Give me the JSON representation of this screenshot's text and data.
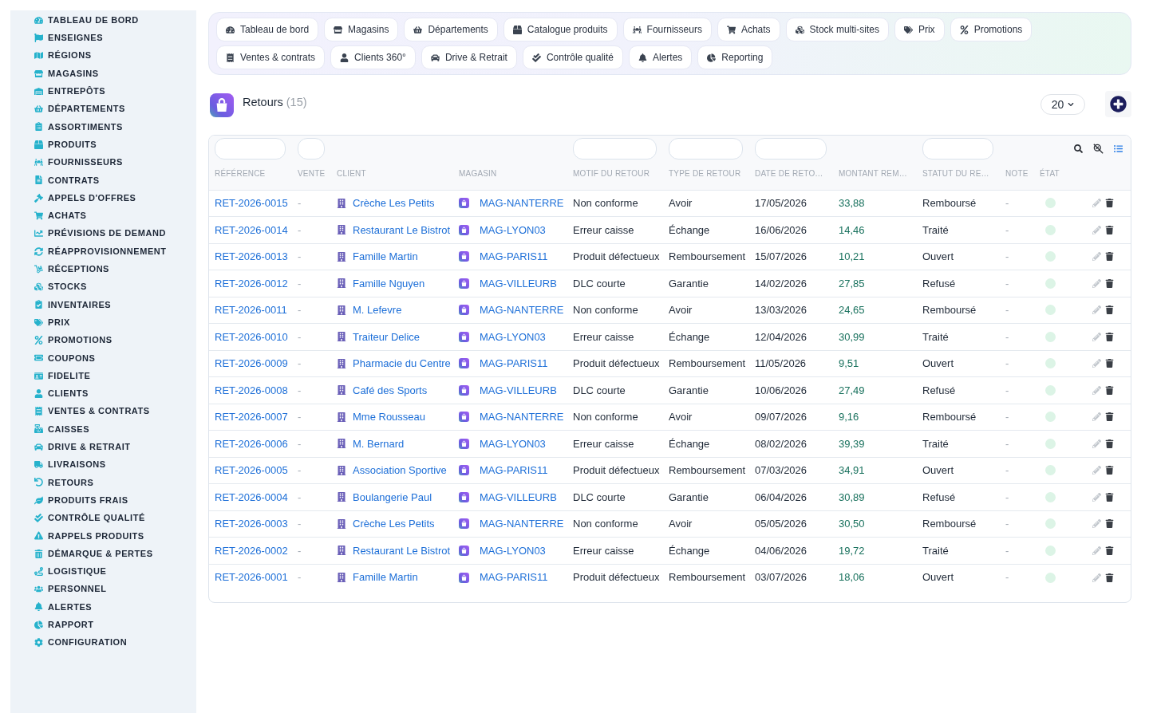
{
  "sidebar": {
    "items": [
      {
        "label": "TABLEAU DE BORD"
      },
      {
        "label": "ENSEIGNES"
      },
      {
        "label": "RÉGIONS"
      },
      {
        "label": "MAGASINS"
      },
      {
        "label": "ENTREPÔTS"
      },
      {
        "label": "DÉPARTEMENTS"
      },
      {
        "label": "ASSORTIMENTS"
      },
      {
        "label": "PRODUITS"
      },
      {
        "label": "FOURNISSEURS"
      },
      {
        "label": "CONTRATS"
      },
      {
        "label": "APPELS D'OFFRES"
      },
      {
        "label": "ACHATS"
      },
      {
        "label": "PRÉVISIONS DE DEMAND"
      },
      {
        "label": "RÉAPPROVISIONNEMENT"
      },
      {
        "label": "RÉCEPTIONS"
      },
      {
        "label": "STOCKS"
      },
      {
        "label": "INVENTAIRES"
      },
      {
        "label": "PRIX"
      },
      {
        "label": "PROMOTIONS"
      },
      {
        "label": "COUPONS"
      },
      {
        "label": "FIDELITE"
      },
      {
        "label": "CLIENTS"
      },
      {
        "label": "VENTES & CONTRATS"
      },
      {
        "label": "CAISSES"
      },
      {
        "label": "DRIVE & RETRAIT"
      },
      {
        "label": "LIVRAISONS"
      },
      {
        "label": "RETOURS"
      },
      {
        "label": "PRODUITS FRAIS"
      },
      {
        "label": "CONTRÔLE QUALITÉ"
      },
      {
        "label": "RAPPELS PRODUITS"
      },
      {
        "label": "DÉMARQUE & PERTES"
      },
      {
        "label": "LOGISTIQUE"
      },
      {
        "label": "PERSONNEL"
      },
      {
        "label": "ALERTES"
      },
      {
        "label": "RAPPORT"
      },
      {
        "label": "CONFIGURATION"
      }
    ]
  },
  "shortcuts": {
    "rows": [
      [
        {
          "label": "Tableau de bord"
        },
        {
          "label": "Magasins"
        },
        {
          "label": "Départements"
        },
        {
          "label": "Catalogue produits"
        },
        {
          "label": "Fournisseurs"
        },
        {
          "label": "Achats"
        },
        {
          "label": "Stock multi-sites"
        },
        {
          "label": "Prix"
        },
        {
          "label": "Promotions"
        }
      ],
      [
        {
          "label": "Ventes & contrats"
        },
        {
          "label": "Clients 360°"
        },
        {
          "label": "Drive & Retrait"
        },
        {
          "label": "Contrôle qualité"
        },
        {
          "label": "Alertes"
        },
        {
          "label": "Reporting"
        }
      ]
    ]
  },
  "page": {
    "title": "Retours",
    "count": "(15)",
    "page_size": "20"
  },
  "table": {
    "columns": [
      {
        "label": "RÉFÉRENCE",
        "filter": true
      },
      {
        "label": "VENTE",
        "filter": true
      },
      {
        "label": "CLIENT",
        "filter": false
      },
      {
        "label": "MAGASIN",
        "filter": false
      },
      {
        "label": "MOTIF DU RETOUR",
        "filter": true
      },
      {
        "label": "TYPE DE RETOUR",
        "filter": true
      },
      {
        "label": "DATE DE RETO…",
        "filter": true
      },
      {
        "label": "MONTANT REM…",
        "filter": false
      },
      {
        "label": "STATUT DU RE…",
        "filter": true
      },
      {
        "label": "NOTE",
        "filter": false
      },
      {
        "label": "ÉTAT",
        "filter": false
      }
    ],
    "rows": [
      {
        "reference": "RET-2026-0015",
        "sale": "-",
        "client": "Crèche Les Petits",
        "store": "MAG-NANTERRE",
        "reason": "Non conforme",
        "type": "Avoir",
        "date": "17/05/2026",
        "amount": "33,88",
        "status": "Remboursé",
        "note": "-",
        "color": "#dcf4e6"
      },
      {
        "reference": "RET-2026-0014",
        "sale": "-",
        "client": "Restaurant Le Bistrot",
        "store": "MAG-LYON03",
        "reason": "Erreur caisse",
        "type": "Échange",
        "date": "16/06/2026",
        "amount": "14,46",
        "status": "Traité",
        "note": "-",
        "color": "#dcf4e6"
      },
      {
        "reference": "RET-2026-0013",
        "sale": "-",
        "client": "Famille Martin",
        "store": "MAG-PARIS11",
        "reason": "Produit défectueux",
        "type": "Remboursement",
        "date": "15/07/2026",
        "amount": "10,21",
        "status": "Ouvert",
        "note": "-",
        "color": "#dcf4e6"
      },
      {
        "reference": "RET-2026-0012",
        "sale": "-",
        "client": "Famille Nguyen",
        "store": "MAG-VILLEURB",
        "reason": "DLC courte",
        "type": "Garantie",
        "date": "14/02/2026",
        "amount": "27,85",
        "status": "Refusé",
        "note": "-",
        "color": "#dcf4e6"
      },
      {
        "reference": "RET-2026-0011",
        "sale": "-",
        "client": "M. Lefevre",
        "store": "MAG-NANTERRE",
        "reason": "Non conforme",
        "type": "Avoir",
        "date": "13/03/2026",
        "amount": "24,65",
        "status": "Remboursé",
        "note": "-",
        "color": "#dcf4e6"
      },
      {
        "reference": "RET-2026-0010",
        "sale": "-",
        "client": "Traiteur Delice",
        "store": "MAG-LYON03",
        "reason": "Erreur caisse",
        "type": "Échange",
        "date": "12/04/2026",
        "amount": "30,99",
        "status": "Traité",
        "note": "-",
        "color": "#dcf4e6"
      },
      {
        "reference": "RET-2026-0009",
        "sale": "-",
        "client": "Pharmacie du Centre",
        "store": "MAG-PARIS11",
        "reason": "Produit défectueux",
        "type": "Remboursement",
        "date": "11/05/2026",
        "amount": "9,51",
        "status": "Ouvert",
        "note": "-",
        "color": "#dcf4e6"
      },
      {
        "reference": "RET-2026-0008",
        "sale": "-",
        "client": "Café des Sports",
        "store": "MAG-VILLEURB",
        "reason": "DLC courte",
        "type": "Garantie",
        "date": "10/06/2026",
        "amount": "27,49",
        "status": "Refusé",
        "note": "-",
        "color": "#dcf4e6"
      },
      {
        "reference": "RET-2026-0007",
        "sale": "-",
        "client": "Mme Rousseau",
        "store": "MAG-NANTERRE",
        "reason": "Non conforme",
        "type": "Avoir",
        "date": "09/07/2026",
        "amount": "9,16",
        "status": "Remboursé",
        "note": "-",
        "color": "#dcf4e6"
      },
      {
        "reference": "RET-2026-0006",
        "sale": "-",
        "client": "M. Bernard",
        "store": "MAG-LYON03",
        "reason": "Erreur caisse",
        "type": "Échange",
        "date": "08/02/2026",
        "amount": "39,39",
        "status": "Traité",
        "note": "-",
        "color": "#dcf4e6"
      },
      {
        "reference": "RET-2026-0005",
        "sale": "-",
        "client": "Association Sportive",
        "store": "MAG-PARIS11",
        "reason": "Produit défectueux",
        "type": "Remboursement",
        "date": "07/03/2026",
        "amount": "34,91",
        "status": "Ouvert",
        "note": "-",
        "color": "#dcf4e6"
      },
      {
        "reference": "RET-2026-0004",
        "sale": "-",
        "client": "Boulangerie Paul",
        "store": "MAG-VILLEURB",
        "reason": "DLC courte",
        "type": "Garantie",
        "date": "06/04/2026",
        "amount": "30,89",
        "status": "Refusé",
        "note": "-",
        "color": "#dcf4e6"
      },
      {
        "reference": "RET-2026-0003",
        "sale": "-",
        "client": "Crèche Les Petits",
        "store": "MAG-NANTERRE",
        "reason": "Non conforme",
        "type": "Avoir",
        "date": "05/05/2026",
        "amount": "30,50",
        "status": "Remboursé",
        "note": "-",
        "color": "#dcf4e6"
      },
      {
        "reference": "RET-2026-0002",
        "sale": "-",
        "client": "Restaurant Le Bistrot",
        "store": "MAG-LYON03",
        "reason": "Erreur caisse",
        "type": "Échange",
        "date": "04/06/2026",
        "amount": "19,72",
        "status": "Traité",
        "note": "-",
        "color": "#dcf4e6"
      },
      {
        "reference": "RET-2026-0001",
        "sale": "-",
        "client": "Famille Martin",
        "store": "MAG-PARIS11",
        "reason": "Produit défectueux",
        "type": "Remboursement",
        "date": "03/07/2026",
        "amount": "18,06",
        "status": "Ouvert",
        "note": "-",
        "color": "#dcf4e6"
      }
    ]
  }
}
